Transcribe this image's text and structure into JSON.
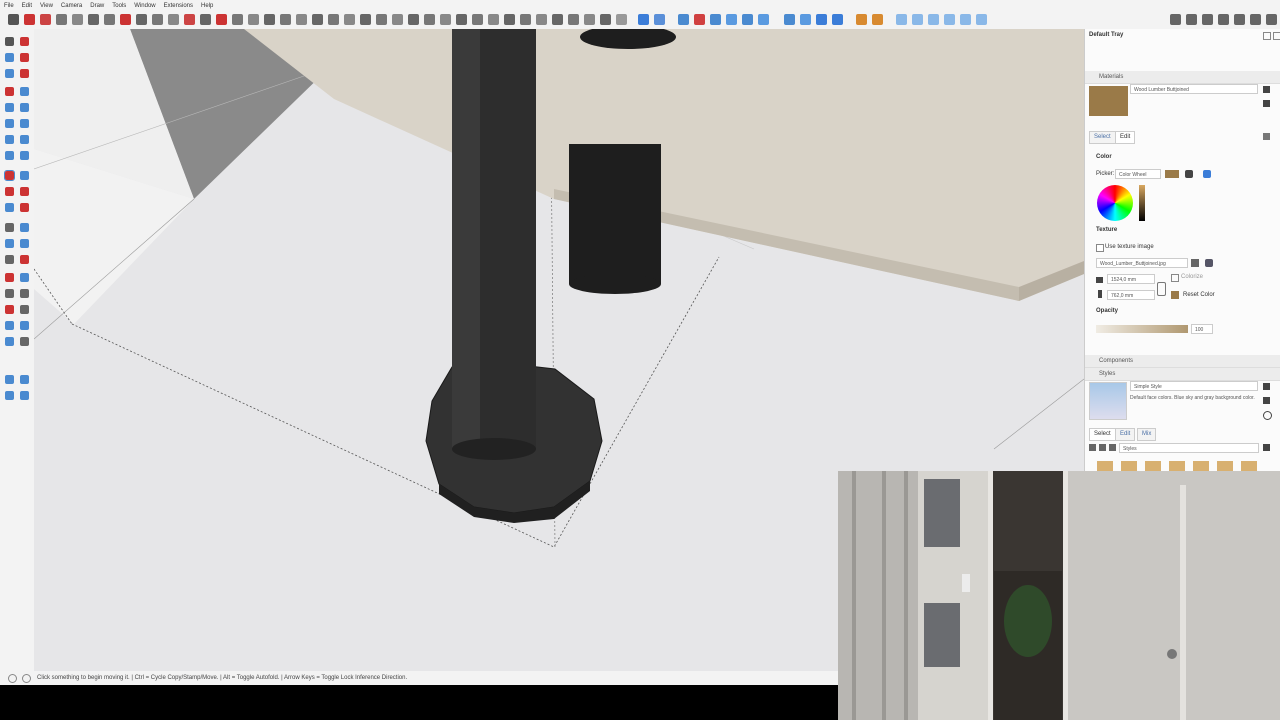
{
  "menu": {
    "items": [
      "File",
      "Edit",
      "View",
      "Camera",
      "Draw",
      "Tools",
      "Window",
      "Extensions",
      "Help"
    ]
  },
  "status": {
    "hint": "Click something to begin moving it. | Ctrl = Cycle Copy/Stamp/Move. | Alt = Toggle Autofold. | Arrow Keys = Toggle Lock Inference Direction."
  },
  "tray": {
    "title": "Default Tray",
    "materials": {
      "header": "Materials",
      "name": "Wood Lumber Buttjoined",
      "tab_select": "Select",
      "tab_edit": "Edit",
      "color_label": "Color",
      "picker_label": "Picker:",
      "picker_value": "Color Wheel",
      "texture_label": "Texture",
      "use_texture": "Use texture image",
      "texture_file": "Wood_Lumber_Buttjoined.jpg",
      "width": "1524,0 mm",
      "height": "762,0 mm",
      "colorize": "Colorize",
      "reset_color": "Reset Color",
      "opacity_label": "Opacity",
      "opacity_value": "100"
    },
    "components": {
      "header": "Components"
    },
    "styles": {
      "header": "Styles",
      "style_name": "Simple Style",
      "style_desc": "Default face colors. Blue sky and gray background color.",
      "tab_select": "Select",
      "tab_edit": "Edit",
      "tab_mix": "Mix",
      "collection": "Styles"
    }
  },
  "colors": {
    "accent": "#4a6fa5",
    "wood": "#d8d2c6",
    "post": "#2b2b2b",
    "swatch": "#9a7a48"
  }
}
